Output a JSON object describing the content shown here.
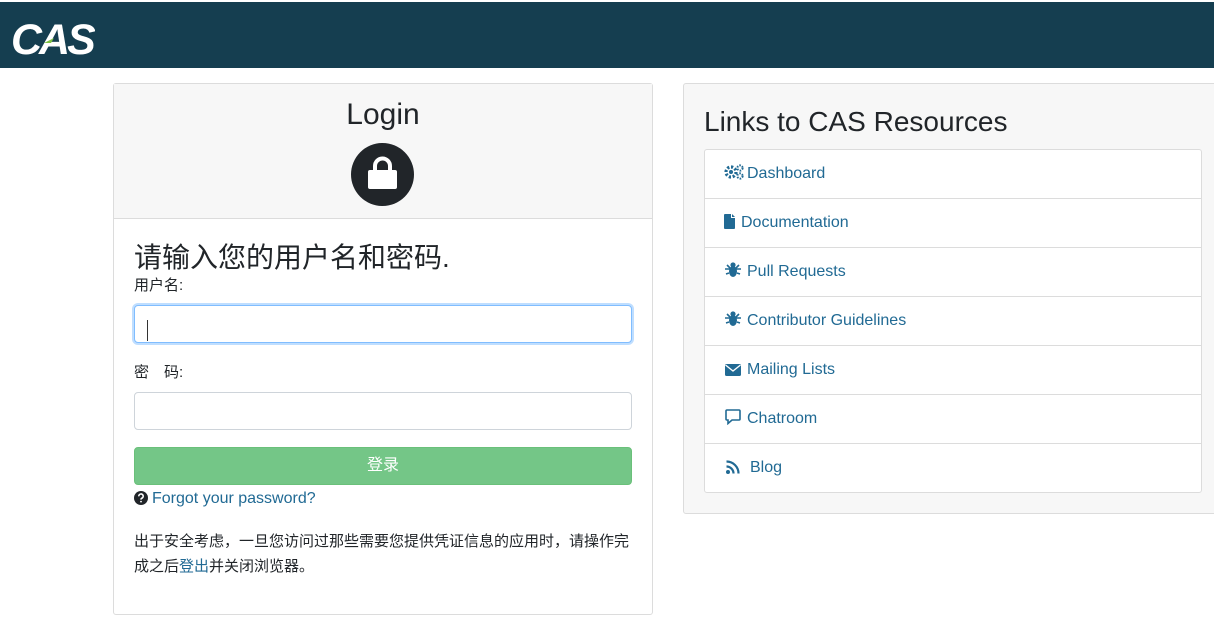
{
  "brand": {
    "logo_text": "CAS",
    "header_color": "#153e50"
  },
  "login": {
    "title": "Login",
    "heading": "请输入您的用户名和密码.",
    "username_label": "用户名:",
    "username_value": "",
    "password_label": "密　码:",
    "password_value": "",
    "submit_label": "登录",
    "forgot_label": "Forgot your password?",
    "notice_part1": "出于安全考虑，一旦您访问过那些需要您提供凭证信息的应用时，请操作完成之后",
    "notice_link": "登出",
    "notice_part2": "并关闭浏览器。",
    "button_color": "#74c687"
  },
  "resources": {
    "title": "Links to CAS Resources",
    "items": [
      {
        "label": "Dashboard",
        "icon": "gears-icon"
      },
      {
        "label": "Documentation",
        "icon": "file-icon"
      },
      {
        "label": "Pull Requests",
        "icon": "bug-icon"
      },
      {
        "label": "Contributor Guidelines",
        "icon": "bug-icon"
      },
      {
        "label": "Mailing Lists",
        "icon": "envelope-icon"
      },
      {
        "label": "Chatroom",
        "icon": "comment-icon"
      },
      {
        "label": "Blog",
        "icon": "rss-icon"
      }
    ],
    "link_color": "#216a94"
  }
}
